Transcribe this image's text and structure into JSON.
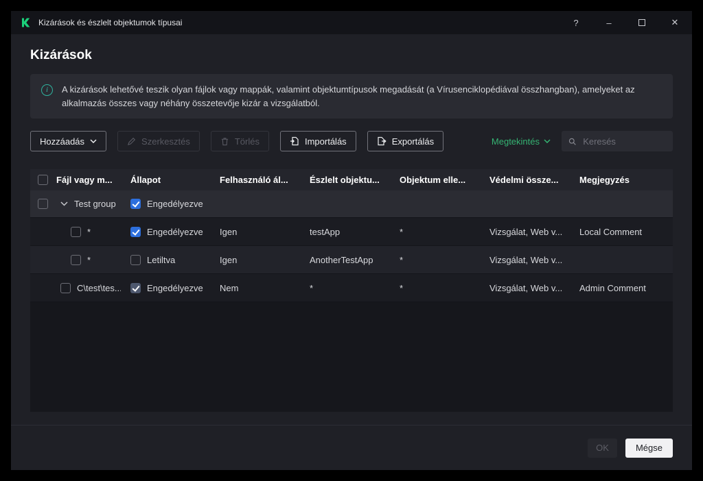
{
  "window": {
    "title": "Kizárások és észlelt objektumok típusai",
    "controls": {
      "help": "?",
      "minimize": "–",
      "close": "✕"
    }
  },
  "page": {
    "title": "Kizárások"
  },
  "info_banner": {
    "text": "A kizárások lehetővé teszik olyan fájlok vagy mappák, valamint objektumtípusok megadását (a Vírusenciklopédiával összhangban), amelyeket az alkalmazás összes vagy néhány összetevője kizár a vizsgálatból."
  },
  "toolbar": {
    "add_label": "Hozzáadás",
    "edit_label": "Szerkesztés",
    "delete_label": "Törlés",
    "import_label": "Importálás",
    "export_label": "Exportálás",
    "view_label": "Megtekintés",
    "search_placeholder": "Keresés"
  },
  "table": {
    "columns": [
      "Fájl vagy m...",
      "Állapot",
      "Felhasználó ál...",
      "Észlelt objektu...",
      "Objektum elle...",
      "Védelmi össze...",
      "Megjegyzés"
    ],
    "group": {
      "name": "Test group",
      "status_label": "Engedélyezve",
      "checked": true
    },
    "rows": [
      {
        "file": "*",
        "status_label": "Engedélyezve",
        "status_checked": true,
        "status_disabled": false,
        "user": "Igen",
        "detected": "testApp",
        "object_mask": "*",
        "protection": "Vizsgálat, Web v...",
        "comment": "Local Comment",
        "in_group": true
      },
      {
        "file": "*",
        "status_label": "Letiltva",
        "status_checked": false,
        "status_disabled": false,
        "user": "Igen",
        "detected": "AnotherTestApp",
        "object_mask": "*",
        "protection": "Vizsgálat, Web v...",
        "comment": "",
        "in_group": true
      },
      {
        "file": "C\\test\\tes...",
        "status_label": "Engedélyezve",
        "status_checked": true,
        "status_disabled": true,
        "user": "Nem",
        "detected": "*",
        "object_mask": "*",
        "protection": "Vizsgálat, Web v...",
        "comment": "Admin Comment",
        "in_group": false
      }
    ]
  },
  "footer": {
    "ok_label": "OK",
    "cancel_label": "Mégse"
  },
  "colors": {
    "accent_green": "#35b473",
    "checkbox_blue": "#2d6fdd",
    "info_teal": "#2fb5a0"
  }
}
